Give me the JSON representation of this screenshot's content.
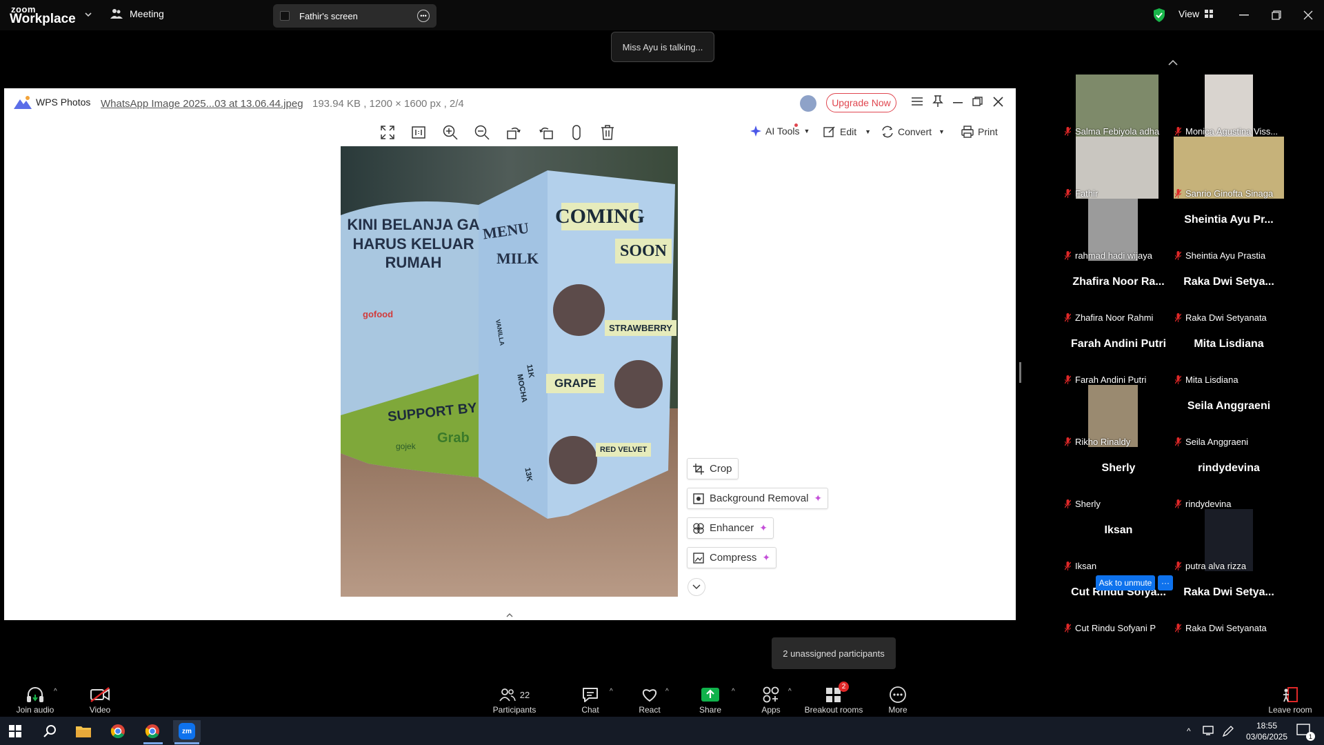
{
  "topbar": {
    "logo_line1": "zoom",
    "logo_line2": "Workplace",
    "meeting_label": "Meeting",
    "screen_label": "Fathir's screen",
    "view_label": "View"
  },
  "talking_indicator": "Miss Ayu is talking...",
  "wps": {
    "app_name": "WPS Photos",
    "file_name": "WhatsApp Image 2025...03 at 13.06.44.jpeg",
    "file_meta": "193.94 KB , 1200 × 1600 px , 2/4",
    "upgrade_label": "Upgrade Now",
    "ai_tools_label": "AI Tools",
    "edit_label": "Edit",
    "convert_label": "Convert",
    "print_label": "Print",
    "crop_label": "Crop",
    "bg_removal_label": "Background Removal",
    "enhancer_label": "Enhancer",
    "compress_label": "Compress"
  },
  "photo_text": {
    "left_panel": [
      "KINI BELANJA GA",
      "HARUS KELUAR",
      "RUMAH"
    ],
    "gofood": "gofood",
    "support": "SUPPORT BY",
    "gojek": "gojek",
    "grab": "Grab",
    "menu": "MENU",
    "milk": "MILK",
    "coming": "COMING",
    "soon": "SOON",
    "strawberry": "STRAWBERRY",
    "grape": "GRAPE",
    "red_velvet": "RED VELVET",
    "vanilla": "VANILLA",
    "mocha": "MOCHA",
    "price1": "11K",
    "price2": "13K"
  },
  "gallery": {
    "participants": [
      {
        "name": "Salma Febiyola adha",
        "video": true,
        "color": "#7e8a6a"
      },
      {
        "name": "Monica Agustina Viss...",
        "video": true,
        "color": "#d9d4cf"
      },
      {
        "name": "Fathir",
        "video": true,
        "color": "#c9c6c0"
      },
      {
        "name": "Sanrio Ginofta Sinaga",
        "video": true,
        "color": "#c6b27a"
      },
      {
        "name": "rahmad hadi wijaya",
        "video": true,
        "color": "#9b9b9b"
      },
      {
        "name": "Sheintia Ayu Prastia",
        "big": "Sheintia Ayu Pr..."
      },
      {
        "name": "Zhafira Noor Rahmi",
        "big": "Zhafira Noor Ra..."
      },
      {
        "name": "Raka Dwi Setyanata",
        "big": "Raka Dwi Setya..."
      },
      {
        "name": "Farah Andini Putri",
        "big": "Farah Andini Putri"
      },
      {
        "name": "Mita Lisdiana",
        "big": "Mita Lisdiana"
      },
      {
        "name": "Rikho Rinaldy",
        "video": true,
        "color": "#9a8a70"
      },
      {
        "name": "Seila Anggraeni",
        "big": "Seila Anggraeni"
      },
      {
        "name": "Sherly",
        "big": "Sherly"
      },
      {
        "name": "rindydevina",
        "big": "rindydevina"
      },
      {
        "name": "Iksan",
        "big": "Iksan"
      },
      {
        "name": "putra alva rizza",
        "video": true,
        "color": "#1a1d26"
      },
      {
        "name": "Cut Rindu Sofyani P",
        "big": "Cut Rindu Sofya..."
      },
      {
        "name": "Raka Dwi Setyanata",
        "big": "Raka Dwi Setya..."
      }
    ],
    "ask_unmute": "Ask to unmute",
    "more_dots": "···"
  },
  "unassigned": "2 unassigned participants",
  "toolbar": {
    "join_audio": "Join audio",
    "video": "Video",
    "participants": "Participants",
    "participants_count": "22",
    "chat": "Chat",
    "react": "React",
    "share": "Share",
    "apps": "Apps",
    "breakout": "Breakout rooms",
    "breakout_badge": "2",
    "more": "More",
    "leave": "Leave room"
  },
  "taskbar": {
    "time": "18:55",
    "date": "03/06/2025",
    "notif_count": "1"
  },
  "colors": {
    "upgrade": "#e0464f",
    "share_green": "#10b24b",
    "ask_unmute": "#0e72ed",
    "video_red": "#e02828",
    "mic_red": "#e02828"
  }
}
